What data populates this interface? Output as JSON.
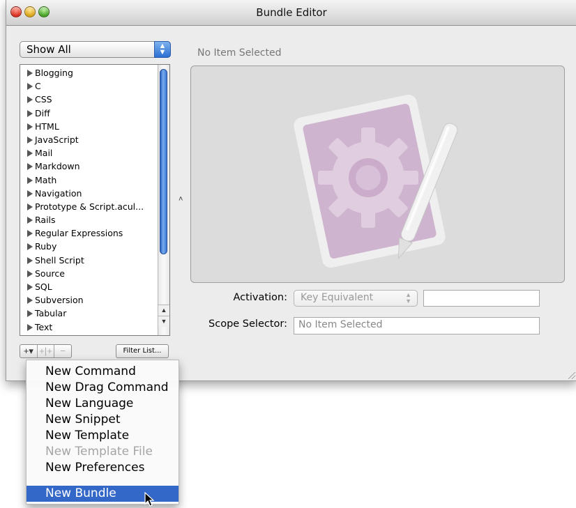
{
  "window": {
    "title": "Bundle Editor"
  },
  "filter_popup": {
    "selected": "Show All"
  },
  "bundle_list": {
    "items": [
      "Blogging",
      "C",
      "CSS",
      "Diff",
      "HTML",
      "JavaScript",
      "Mail",
      "Markdown",
      "Math",
      "Navigation",
      "Prototype & Script.acul...",
      "Rails",
      "Regular Expressions",
      "Ruby",
      "Shell Script",
      "Source",
      "SQL",
      "Subversion",
      "Tabular",
      "Text"
    ]
  },
  "toolbar": {
    "add_label": "+▾",
    "add_group_label": "+|+",
    "remove_label": "−",
    "filter_label": "Filter List..."
  },
  "editor": {
    "header": "No Item Selected",
    "activation_label": "Activation:",
    "activation_value": "Key Equivalent",
    "activation_key": "",
    "scope_label": "Scope Selector:",
    "scope_value": "No Item Selected"
  },
  "add_menu": {
    "items": [
      {
        "label": "New Command",
        "state": "normal"
      },
      {
        "label": "New Drag Command",
        "state": "normal"
      },
      {
        "label": "New Language",
        "state": "normal"
      },
      {
        "label": "New Snippet",
        "state": "normal"
      },
      {
        "label": "New Template",
        "state": "normal"
      },
      {
        "label": "New Template File",
        "state": "disabled"
      },
      {
        "label": "New Preferences",
        "state": "normal"
      },
      {
        "label": "New Bundle",
        "state": "selected"
      }
    ]
  },
  "colors": {
    "selection": "#3468c8",
    "placeholder_art": "#c9a9c9"
  }
}
